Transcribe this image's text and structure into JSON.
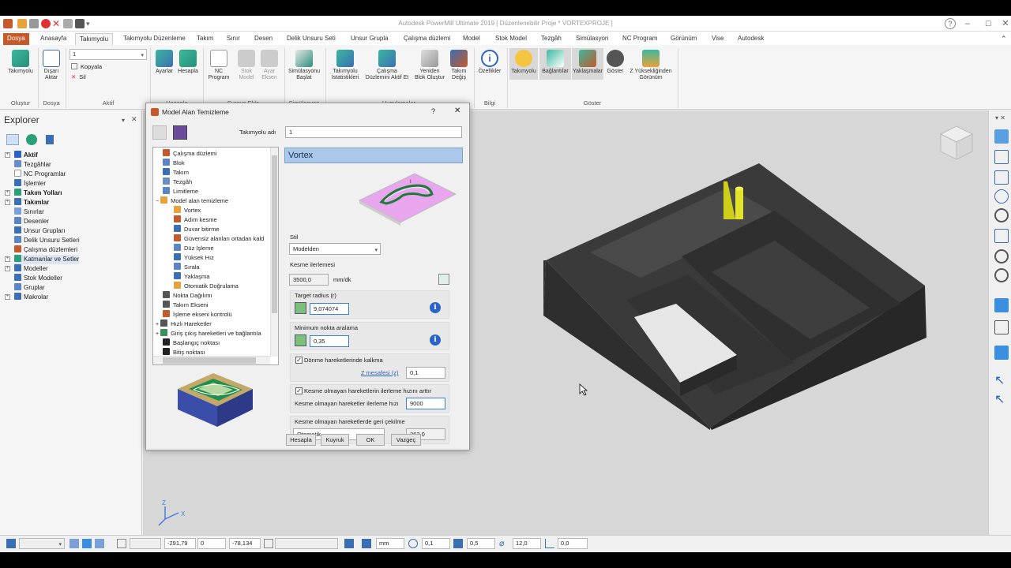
{
  "titlebar": {
    "title": "Autodesk PowerMill Ultimate 2019   [ Düzenlenebilir Proje * VORTEXPROJE ]"
  },
  "tabs": [
    "Dosya",
    "Anasayfa",
    "Takımyolu",
    "Takımyolu Düzenleme",
    "Takım",
    "Sınır",
    "Desen",
    "Delik Unsuru Seti",
    "Unsur Grupla",
    "Çalışma düzlemi",
    "Model",
    "Stok Model",
    "Tezgâh",
    "Simülasyon",
    "NC Program",
    "Görünüm",
    "Vise",
    "Autodesk"
  ],
  "ribbon": {
    "olustur": {
      "takimyolu": "Takımyolu",
      "group": "Oluştur"
    },
    "dosya": {
      "disari1": "Dışarı",
      "disari2": "Aktar",
      "group": "Dosya"
    },
    "aktif": {
      "selected": "1",
      "kopyala": "Kopyala",
      "sil": "Sil",
      "group": "Aktif"
    },
    "hesapla": {
      "ayarlar": "Ayarlar",
      "hesapla": "Hesapla",
      "group": "Hesapla"
    },
    "suraya": {
      "nc1": "NC",
      "nc2": "Program",
      "stok1": "Stok",
      "stok2": "Model",
      "ayar1": "Ayar",
      "ayar2": "Eksen",
      "group": "Şuraya Ekle"
    },
    "simulasyon": {
      "l1": "Simülasyonu",
      "l2": "Başlat",
      "group": "Simülasyon"
    },
    "uygulamalar": {
      "a1": "Takımyolu",
      "a2": "İstatistikleri",
      "b1": "Çalışma",
      "b2": "Düzlemini Aktif Et",
      "c1": "Yeniden",
      "c2": "Blok Oluştur",
      "d1": "Takım",
      "d2": "Değiş",
      "group": "Uygulamalar"
    },
    "bilgi": {
      "ozellikler": "Özellikler",
      "group": "Bilgi"
    },
    "goster": {
      "takimyolu": "Takımyolu",
      "baglantilar": "Bağlantılar",
      "yaklasmalar": "Yaklaşmalar",
      "goster": "Göster",
      "z1": "Z Yüksekliğinden",
      "z2": "Görünüm",
      "group": "Göster"
    }
  },
  "explorer": {
    "title": "Explorer",
    "items": [
      "Aktif",
      "Tezgâhlar",
      "NC Programlar",
      "İşlemler",
      "Takım Yolları",
      "Takımlar",
      "Sınırlar",
      "Desenler",
      "Unsur Grupları",
      "Delik Unsuru Setleri",
      "Çalışma düzlemleri",
      "Katmanlar ve Setler",
      "Modeller",
      "Stok Modeller",
      "Gruplar",
      "Makrolar"
    ]
  },
  "dialog": {
    "title": "Model Alan Temizleme",
    "help": "?",
    "takimyolu_label": "Takımyolu adı",
    "takimyolu_value": "1",
    "section_title": "Vortex",
    "tree": [
      "Çalışma düzlemi",
      "Blok",
      "Takım",
      "Tezgâh",
      "Limitleme",
      "Model alan temizleme",
      "Vortex",
      "Adım kesme",
      "Duvar bitirme",
      "Güvensiz alanları ortadan kald",
      "Düz İşleme",
      "Yüksek Hız",
      "Sırala",
      "Yaklaşma",
      "Otomatik Doğrulama",
      "Nokta Dağılımı",
      "Takım Ekseni",
      "İşleme ekseni kontrolü",
      "Hızlı Hareketler",
      "Giriş çıkış hareketleri ve bağlantıla",
      "Başlangıç noktası",
      "Bitiş noktası"
    ],
    "stil_label": "Stil",
    "stil_value": "Modelden",
    "kesme_label": "Kesme ilerlemesi",
    "kesme_value": "3500,0",
    "kesme_unit": "mm/dk",
    "target_label": "Target radius (r)",
    "target_value": "9,074074",
    "minimum_label": "Minimum nokta aralama",
    "minimum_value": "0,35",
    "donme_label": "Dönme hareketlerinde kalkma",
    "z_label": "Z mesafesi (z)",
    "z_value": "0,1",
    "artir_label": "Kesme olmayan hareketlerin ilerleme hızını arttır",
    "hiz_label": "Kesme olmayan hareketler ilerleme hızı",
    "hiz_value": "9000",
    "geri_label": "Kesme olmayan hareketlerde geri çekilme",
    "geri_value": "Otomatik",
    "geri_number": "362,0",
    "buttons": {
      "hesapla": "Hesapla",
      "kuyruk": "Kuyruk",
      "ok": "OK",
      "vazgec": "Vazgeç"
    }
  },
  "statusbar": {
    "x": "-291,79",
    "y": "0",
    "z": "-78,134",
    "unit": "mm",
    "f1": "0,1",
    "f2": "0,5",
    "f3": "12,0",
    "f4": "0,0"
  },
  "colors": {
    "accent": "#c45a2b",
    "dialog_header": "#a9c8ea",
    "model": "#3a3a3a",
    "viewport": "#d7d7d7"
  }
}
